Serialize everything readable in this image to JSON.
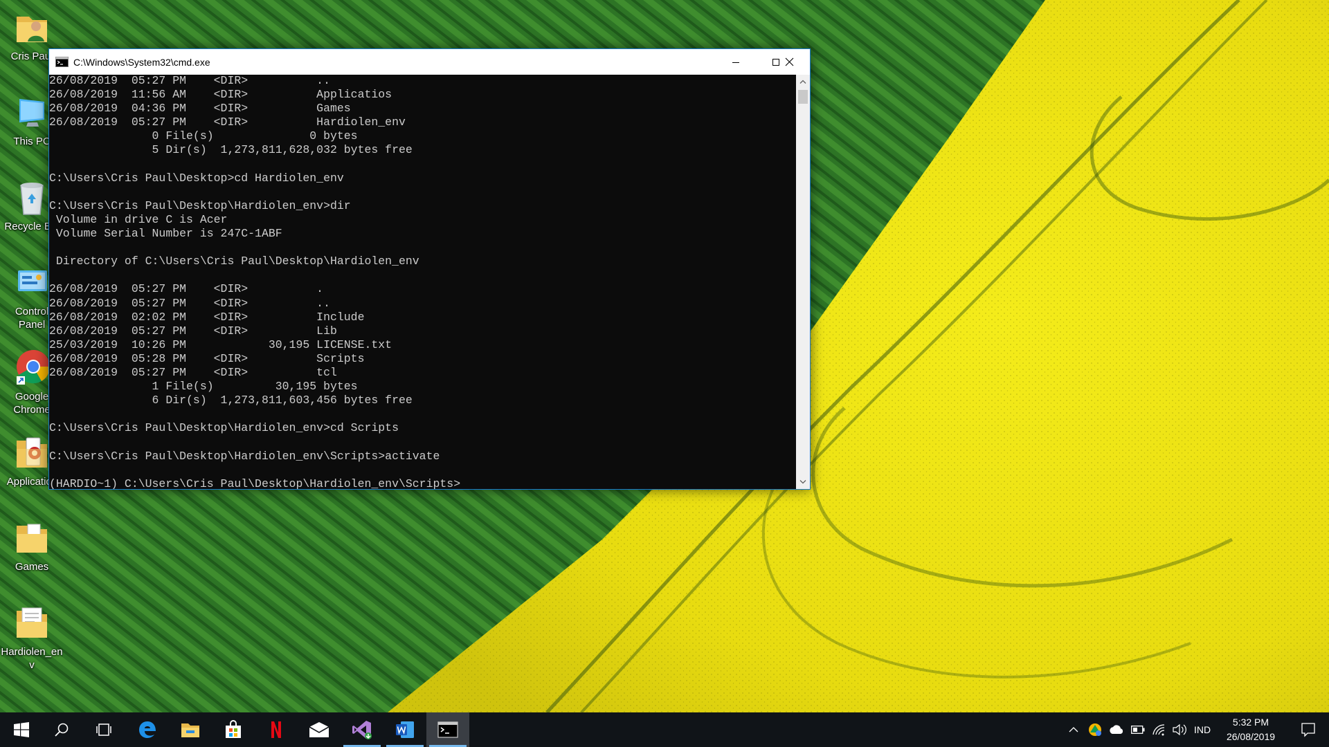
{
  "desktop": {
    "icons": [
      {
        "label": "Cris Paul"
      },
      {
        "label": "This PC"
      },
      {
        "label": "Recycle Bin"
      },
      {
        "label": "Control Panel"
      },
      {
        "label": "Google Chrome"
      },
      {
        "label": "Applicatios"
      },
      {
        "label": "Games"
      },
      {
        "label": "Hardiolen_env"
      }
    ]
  },
  "window": {
    "title": "C:\\Windows\\System32\\cmd.exe",
    "console_lines": [
      "26/08/2019  05:27 PM    <DIR>          ..",
      "26/08/2019  11:56 AM    <DIR>          Applicatios",
      "26/08/2019  04:36 PM    <DIR>          Games",
      "26/08/2019  05:27 PM    <DIR>          Hardiolen_env",
      "               0 File(s)              0 bytes",
      "               5 Dir(s)  1,273,811,628,032 bytes free",
      "",
      "C:\\Users\\Cris Paul\\Desktop>cd Hardiolen_env",
      "",
      "C:\\Users\\Cris Paul\\Desktop\\Hardiolen_env>dir",
      " Volume in drive C is Acer",
      " Volume Serial Number is 247C-1ABF",
      "",
      " Directory of C:\\Users\\Cris Paul\\Desktop\\Hardiolen_env",
      "",
      "26/08/2019  05:27 PM    <DIR>          .",
      "26/08/2019  05:27 PM    <DIR>          ..",
      "26/08/2019  02:02 PM    <DIR>          Include",
      "26/08/2019  05:27 PM    <DIR>          Lib",
      "25/03/2019  10:26 PM            30,195 LICENSE.txt",
      "26/08/2019  05:28 PM    <DIR>          Scripts",
      "26/08/2019  05:27 PM    <DIR>          tcl",
      "               1 File(s)         30,195 bytes",
      "               6 Dir(s)  1,273,811,603,456 bytes free",
      "",
      "C:\\Users\\Cris Paul\\Desktop\\Hardiolen_env>cd Scripts",
      "",
      "C:\\Users\\Cris Paul\\Desktop\\Hardiolen_env\\Scripts>activate",
      "",
      "(HARDIO~1) C:\\Users\\Cris Paul\\Desktop\\Hardiolen_env\\Scripts>"
    ]
  },
  "taskbar": {
    "tray": {
      "language": "IND",
      "time": "5:32 PM",
      "date": "26/08/2019"
    }
  },
  "colors": {
    "console_bg": "#0c0c0c",
    "console_text": "#cccccc",
    "window_border": "#1979ca",
    "taskbar_bg": "#101418",
    "running_indicator": "#76b9ed"
  }
}
